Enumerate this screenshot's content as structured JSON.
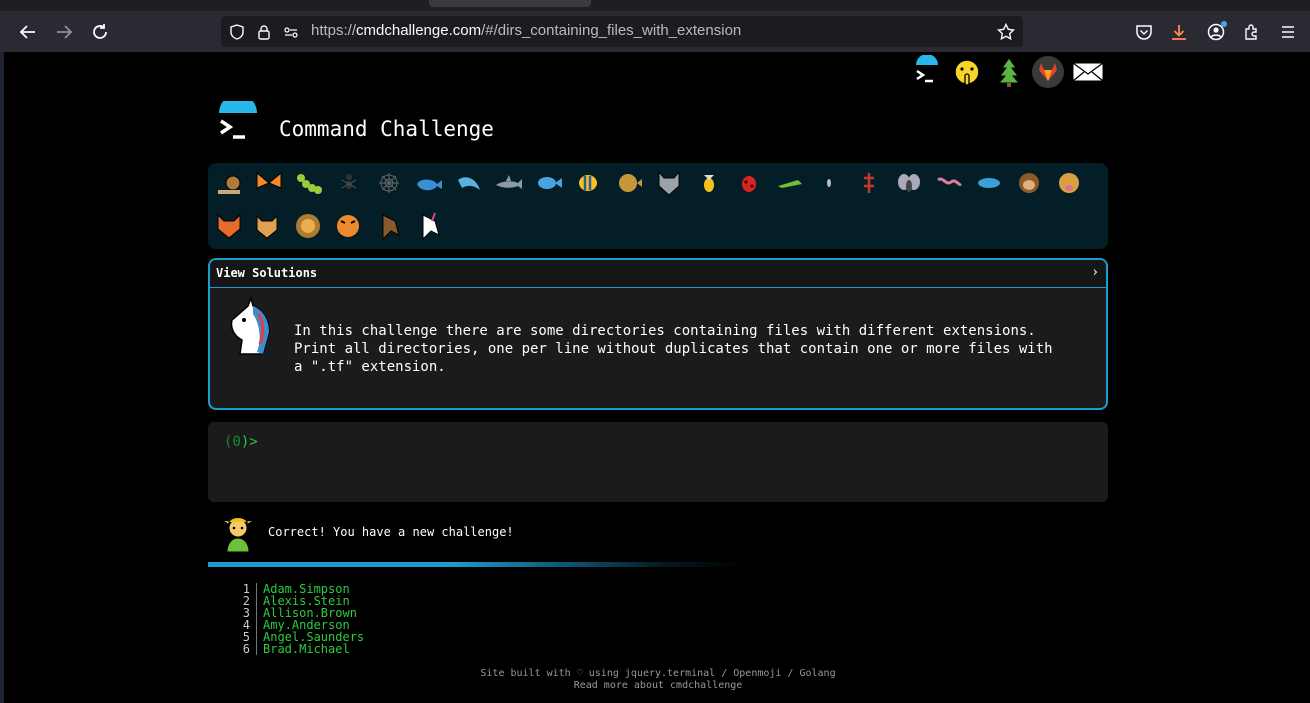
{
  "browser": {
    "url_prefix": "https://",
    "url_domain": "cmdchallenge.com",
    "url_path": "/#/dirs_containing_files_with_extension"
  },
  "site": {
    "title": "Command Challenge"
  },
  "challenge": {
    "solutions_label": "View Solutions",
    "chevron": "›",
    "description_lines": [
      "In this challenge there are some directories containing files with different extensions.",
      "Print all directories, one per line without duplicates that contain one or more files with",
      "a \".tf\" extension."
    ]
  },
  "terminal": {
    "prompt_open": "(",
    "prompt_number": "0",
    "prompt_close": ")>"
  },
  "result": {
    "message": "Correct! You have a new challenge!",
    "progress_percent": 45
  },
  "output_list": [
    {
      "num": "1",
      "name": "Adam.Simpson"
    },
    {
      "num": "2",
      "name": "Alexis.Stein"
    },
    {
      "num": "3",
      "name": "Allison.Brown"
    },
    {
      "num": "4",
      "name": "Amy.Anderson"
    },
    {
      "num": "5",
      "name": "Angel.Saunders"
    },
    {
      "num": "6",
      "name": "Brad.Michael"
    }
  ],
  "footer": {
    "line1": "Site built with ♡ using jquery.terminal / Openmoji / Golang",
    "line2": "Read more about cmdchallenge"
  },
  "animals": [
    "snail-icon",
    "butterfly-icon",
    "caterpillar-icon",
    "ant-icon",
    "spider-web-icon",
    "whale-icon",
    "dolphin-icon",
    "shark-icon",
    "fish-icon",
    "tropical-fish-icon",
    "pufferfish-icon",
    "wolf-icon",
    "bee-icon",
    "ladybug-icon",
    "cricket-icon",
    "mosquito-icon",
    "scorpion-icon",
    "fly-icon",
    "worm-icon",
    "microbe-icon",
    "monkey-icon",
    "dog-icon",
    "fox-icon",
    "cat-icon",
    "lion-icon",
    "tiger-icon",
    "horse-icon",
    "unicorn-icon"
  ],
  "colors": {
    "accent": "#1d9ccf",
    "prompt_green": "#27c93f",
    "panel_bg": "#041e27"
  }
}
